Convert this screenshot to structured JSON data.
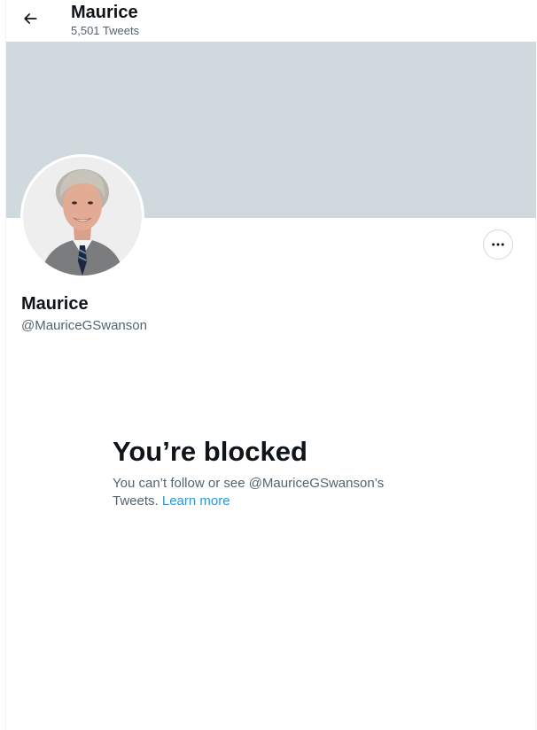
{
  "header": {
    "name": "Maurice",
    "tweet_count": "5,501 Tweets"
  },
  "banner": {
    "color": "#cfd9de"
  },
  "profile": {
    "name": "Maurice",
    "handle": "@MauriceGSwanson"
  },
  "blocked": {
    "title": "You’re blocked",
    "text_before_link": "You can’t follow or see @MauriceGSwanson’s Tweets. ",
    "link_text": "Learn more"
  },
  "colors": {
    "text_primary": "#0f1419",
    "text_secondary": "#536471",
    "link": "#1d9bf0",
    "border": "#cfd9de"
  },
  "icons": {
    "back": "arrow-left-icon",
    "more": "more-horizontal-icon",
    "avatar": "profile-photo"
  }
}
